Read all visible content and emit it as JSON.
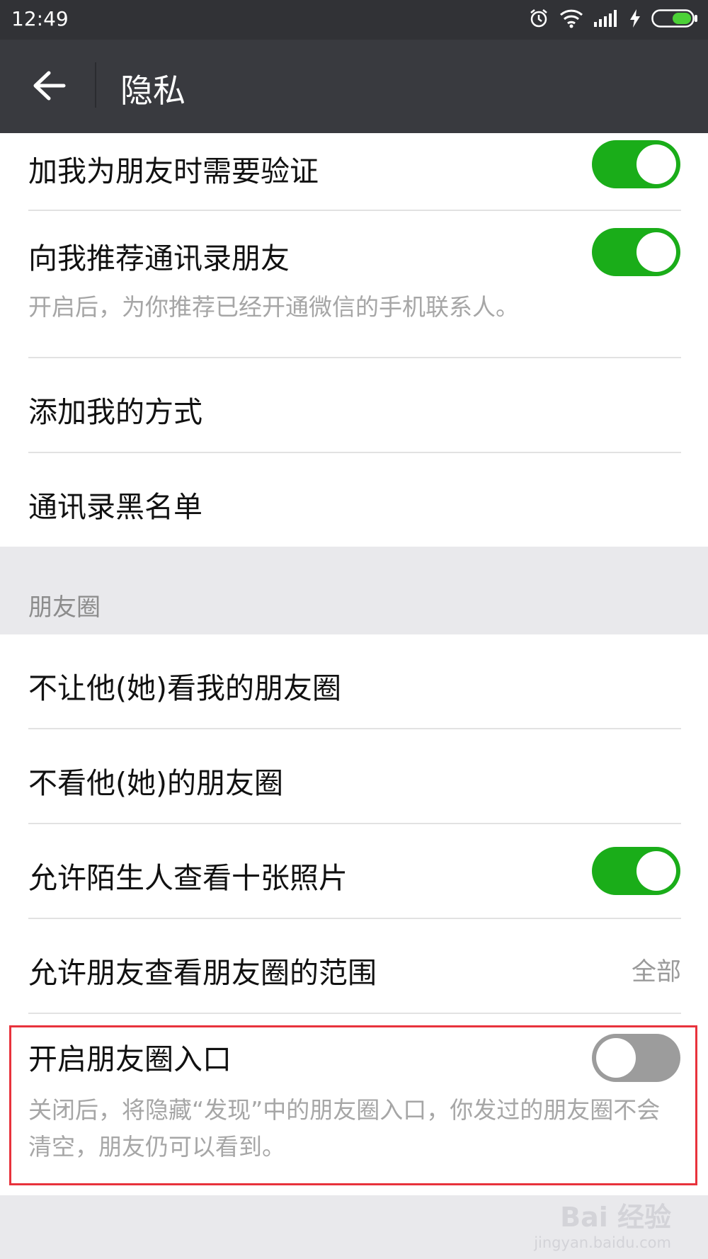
{
  "status_bar": {
    "time": "12:49",
    "icons": [
      "alarm-icon",
      "wifi-icon",
      "signal-icon",
      "charging-icon",
      "battery-icon"
    ]
  },
  "header": {
    "back_icon": "arrow-left-icon",
    "title": "隐私"
  },
  "section_contacts": {
    "items": [
      {
        "label": "加我为朋友时需要验证",
        "toggle": true
      },
      {
        "label": "向我推荐通讯录朋友",
        "toggle": true,
        "description": "开启后，为你推荐已经开通微信的手机联系人。"
      },
      {
        "label": "添加我的方式"
      },
      {
        "label": "通讯录黑名单"
      }
    ]
  },
  "section_moments": {
    "header": "朋友圈",
    "items": [
      {
        "label": "不让他(她)看我的朋友圈"
      },
      {
        "label": "不看他(她)的朋友圈"
      },
      {
        "label": "允许陌生人查看十张照片",
        "toggle": true
      },
      {
        "label": "允许朋友查看朋友圈的范围",
        "value": "全部"
      },
      {
        "label": "开启朋友圈入口",
        "toggle": false,
        "description": "关闭后，将隐藏“发现”中的朋友圈入口，你发过的朋友圈不会清空，朋友仍可以看到。"
      }
    ]
  },
  "watermark": {
    "main": "Bai 经验",
    "sub": "jingyan.baidu.com"
  },
  "colors": {
    "toggle_on": "#1aad19",
    "toggle_off": "#9c9c9c",
    "highlight": "#e8323c",
    "header_bg": "#393a3f"
  }
}
